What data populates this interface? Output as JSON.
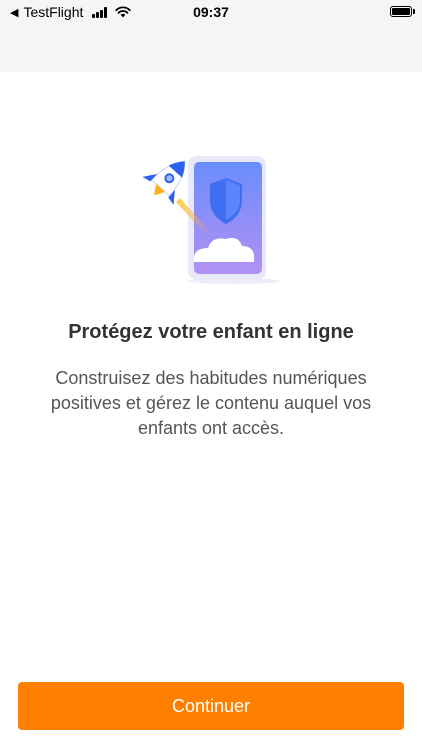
{
  "status_bar": {
    "back_app": "TestFlight",
    "time": "09:37"
  },
  "icons": [
    "back-arrow-icon",
    "signal-icon",
    "wifi-icon",
    "battery-icon",
    "rocket-phone-shield-illustration"
  ],
  "colors": {
    "accent": "#ff7f00",
    "title": "#333333",
    "body_text": "#555555"
  },
  "onboarding": {
    "title": "Protégez votre enfant en ligne",
    "description": "Construisez des habitudes numériques positives et gérez le contenu auquel vos enfants ont accès.",
    "continue_label": "Continuer"
  }
}
